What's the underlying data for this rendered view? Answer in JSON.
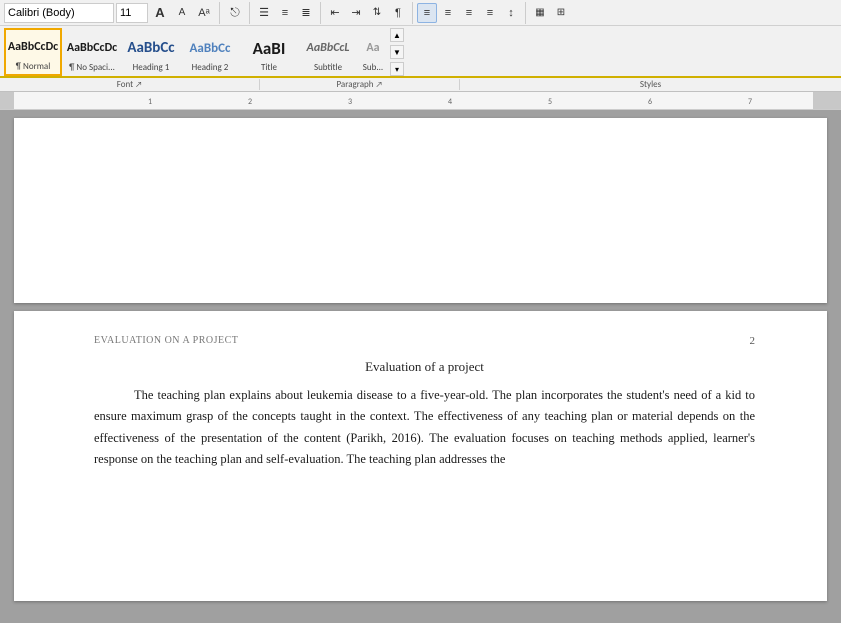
{
  "ribbon": {
    "toolbar_row": {
      "font_name": "Calibri (Body)",
      "font_size": "11",
      "buttons": [
        "A+",
        "A-",
        "Aa▾",
        "¶",
        "↧",
        "↑",
        "↓",
        "☰",
        "≡",
        "≣",
        "↔",
        "↕",
        "⊞"
      ]
    },
    "paragraph_buttons": [
      "≡",
      "≡",
      "≡",
      "≡",
      "↕"
    ],
    "font_section_label": "Font",
    "paragraph_section_label": "Paragraph",
    "styles_section_label": "Styles"
  },
  "styles": [
    {
      "id": "normal",
      "preview_text": "AaBbCcDc",
      "label": "¶ Normal",
      "font_size": "13px",
      "color": "#1a1a1a",
      "selected": true
    },
    {
      "id": "no-spacing",
      "preview_text": "AaBbCcDc",
      "label": "¶ No Spaci...",
      "font_size": "13px",
      "color": "#1a1a1a",
      "selected": false
    },
    {
      "id": "heading1",
      "preview_text": "AaBbCc",
      "label": "Heading 1",
      "font_size": "14px",
      "color": "#264f8c",
      "selected": false
    },
    {
      "id": "heading2",
      "preview_text": "AaBbCc",
      "label": "Heading 2",
      "font_size": "13px",
      "color": "#4f81bd",
      "selected": false
    },
    {
      "id": "title",
      "preview_text": "AaBI",
      "label": "Title",
      "font_size": "16px",
      "color": "#1a1a1a",
      "selected": false
    },
    {
      "id": "subtitle",
      "preview_text": "AaBbCcL",
      "label": "Subtitle",
      "font_size": "12px",
      "color": "#666",
      "selected": false
    }
  ],
  "document": {
    "page1_content": "",
    "page2": {
      "header_title": "EVALUATION ON A PROJECT",
      "header_page_num": "2",
      "title": "Evaluation of a project",
      "body_text": "The teaching plan explains about leukemia disease to a five-year-old.  The plan incorporates the student's need of a kid to ensure maximum  grasp of the concepts taught in the context. The effectiveness of any teaching plan or material  depends on the effectiveness of the presentation of the content (Parikh, 2016).  The evaluation focuses on teaching methods applied, learner's response on the teaching plan and self-evaluation.  The teaching plan addresses the"
    }
  }
}
